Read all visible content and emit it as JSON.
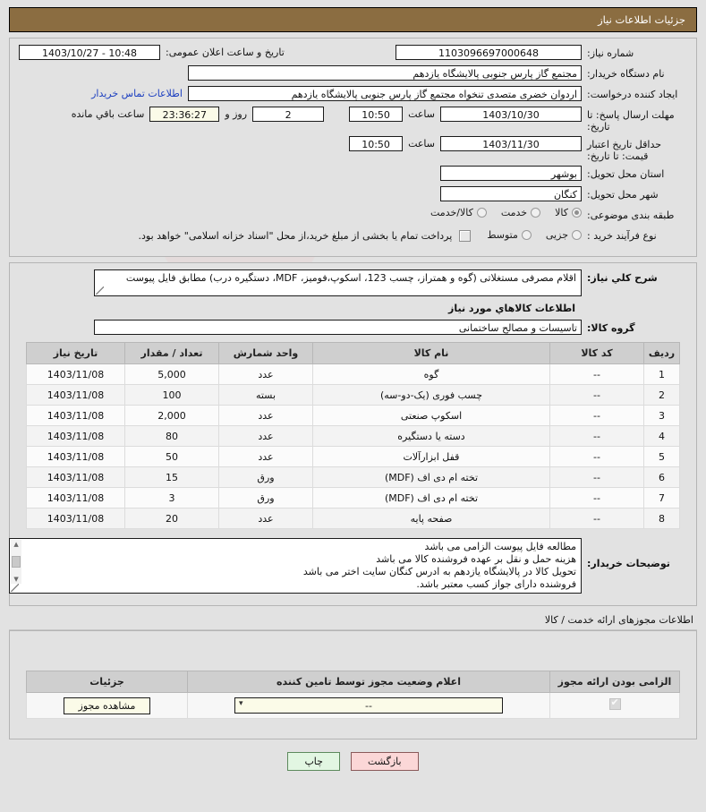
{
  "header": {
    "title": "جزئیات اطلاعات نیاز"
  },
  "form": {
    "need_number_label": "شماره نیاز:",
    "need_number_value": "1103096697000648",
    "announce_label": "تاریخ و ساعت اعلان عمومی:",
    "announce_value": "10:48 - 1403/10/27",
    "buyer_org_label": "نام دستگاه خریدار:",
    "buyer_org_value": "مجتمع گاز پارس جنوبی  پالایشگاه یازدهم",
    "creator_label": "ایجاد کننده درخواست:",
    "creator_value": "اردوان خضری متصدی تنخواه مجتمع گاز پارس جنوبی  پالایشگاه یازدهم",
    "contact_link": "اطلاعات تماس خریدار",
    "deadline_label": "مهلت ارسال پاسخ: تا تاریخ:",
    "deadline_date": "1403/10/30",
    "hour_label": "ساعت",
    "deadline_time": "10:50",
    "days_value": "2",
    "days_label": "روز و",
    "countdown_value": "23:36:27",
    "countdown_label": "ساعت باقي مانده",
    "validity_label": "حداقل تاریخ اعتبار قیمت: تا تاریخ:",
    "validity_date": "1403/11/30",
    "validity_time": "10:50",
    "province_label": "استان محل تحویل:",
    "province_value": "بوشهر",
    "city_label": "شهر محل تحویل:",
    "city_value": "کنگان",
    "category_label": "طبقه بندی موضوعی:",
    "category_options": [
      {
        "label": "کالا",
        "selected": true
      },
      {
        "label": "خدمت",
        "selected": false
      },
      {
        "label": "کالا/خدمت",
        "selected": false
      }
    ],
    "process_label": "نوع فرآیند خرید :",
    "process_options": [
      {
        "label": "جزیی",
        "selected": false
      },
      {
        "label": "متوسط",
        "selected": false
      }
    ],
    "payment_note": "پرداخت تمام یا بخشی از مبلغ خرید،از محل \"اسناد خزانه اسلامی\" خواهد بود."
  },
  "summary": {
    "label": "شرح کلي نیاز:",
    "value": "اقلام مصرفی مستغلاتی (گوه و همتراز، چسب 123، اسکوپ،فومیز، MDF، دستگیره درب) مطابق فایل پیوست"
  },
  "goods_section": {
    "title": "اطلاعات کالاهاي مورد نیاز",
    "group_label": "گروه کالا:",
    "group_value": "تاسیسات و مصالح ساختمانی",
    "columns": [
      "ردیف",
      "کد کالا",
      "نام کالا",
      "واحد شمارش",
      "تعداد / مقدار",
      "تاریخ نیاز"
    ],
    "rows": [
      {
        "row": "1",
        "code": "--",
        "name": "گوه",
        "unit": "عدد",
        "qty": "5,000",
        "date": "1403/11/08"
      },
      {
        "row": "2",
        "code": "--",
        "name": "چسب فوری (یک-دو-سه)",
        "unit": "بسته",
        "qty": "100",
        "date": "1403/11/08"
      },
      {
        "row": "3",
        "code": "--",
        "name": "اسکوپ صنعتی",
        "unit": "عدد",
        "qty": "2,000",
        "date": "1403/11/08"
      },
      {
        "row": "4",
        "code": "--",
        "name": "دسته یا دستگیره",
        "unit": "عدد",
        "qty": "80",
        "date": "1403/11/08"
      },
      {
        "row": "5",
        "code": "--",
        "name": "قفل ابزارآلات",
        "unit": "عدد",
        "qty": "50",
        "date": "1403/11/08"
      },
      {
        "row": "6",
        "code": "--",
        "name": "تخته ام دی اف (MDF)",
        "unit": "ورق",
        "qty": "15",
        "date": "1403/11/08"
      },
      {
        "row": "7",
        "code": "--",
        "name": "تخته ام دی اف (MDF)",
        "unit": "ورق",
        "qty": "3",
        "date": "1403/11/08"
      },
      {
        "row": "8",
        "code": "--",
        "name": "صفحه پایه",
        "unit": "عدد",
        "qty": "20",
        "date": "1403/11/08"
      }
    ]
  },
  "notes": {
    "label": "توضیحات خریدار:",
    "lines": "مطالعه فایل پیوست الزامی می باشد\nهزینه حمل و نقل بر عهده فروشنده کالا می باشد\nتحویل کالا در پالایشگاه یازدهم به ادرس کنگان سایت اختر می باشد\nفروشنده دارای جواز کسب معتبر باشد."
  },
  "licenses": {
    "section_title": "اطلاعات مجوزهای ارائه خدمت / کالا",
    "columns": [
      "الزامی بودن ارائه مجوز",
      "اعلام وضعیت مجوز توسط تامین کننده",
      "جزئیات"
    ],
    "rows": [
      {
        "required_checked": true,
        "status_value": "--",
        "detail_button": "مشاهده مجوز"
      }
    ]
  },
  "footer": {
    "back_label": "بازگشت",
    "print_label": "چاپ"
  },
  "watermark": {
    "text": "iranTender.net"
  },
  "colors": {
    "header_bg": "#8b6d41",
    "link": "#1c3fc0",
    "back_btn": "#fbd7d7",
    "print_btn": "#e2f6e2",
    "cream_field": "#fbfbe8"
  }
}
